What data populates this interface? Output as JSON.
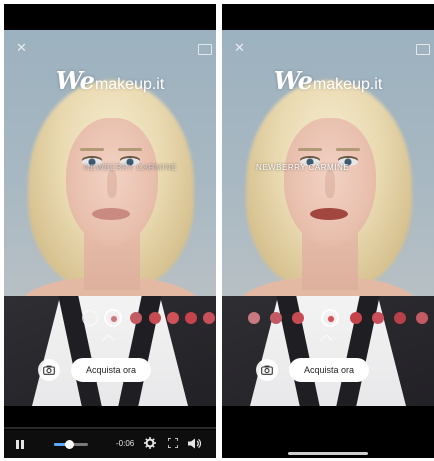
{
  "colors": {
    "lip_natural": "#c98a82",
    "lip_applied": "#a2473f",
    "swatch_palette": [
      "#c97a80",
      "#c45a63",
      "#c84b52",
      "#d05158",
      "#c7434c",
      "#c9505a",
      "#b84048"
    ]
  },
  "left_panel": {
    "logo": {
      "mark": "We",
      "text": "makeup.it"
    },
    "shade_label": "NEWBERRY CARMINE",
    "close_icon": "close-icon",
    "card_icon": "card-icon",
    "camera_icon": "camera-icon",
    "buy_button": "Acquista ora",
    "player": {
      "time": "-0:06",
      "volume_level": 0.45
    }
  },
  "right_panel": {
    "logo": {
      "mark": "We",
      "text": "makeup.it"
    },
    "shade_label": "NEWBERRY CARMINE",
    "close_icon": "close-icon",
    "card_icon": "card-icon",
    "camera_icon": "camera-icon",
    "buy_button": "Acquista ora"
  }
}
